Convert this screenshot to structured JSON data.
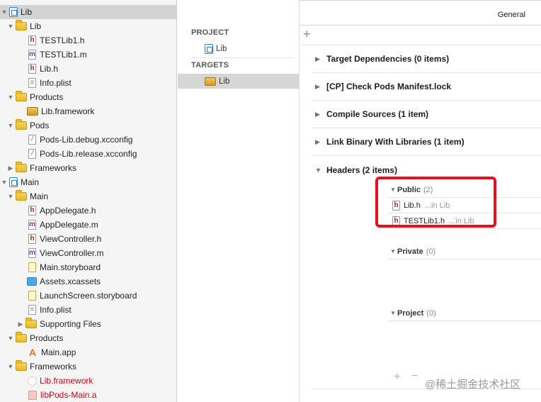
{
  "navigator": {
    "rows": [
      {
        "label": "Lib",
        "icon": "project-icon",
        "depth": 0,
        "disclosure": "expanded",
        "selected": true
      },
      {
        "label": "Lib",
        "icon": "folder-icon",
        "depth": 1,
        "disclosure": "expanded"
      },
      {
        "label": "TESTLib1.h",
        "icon": "header-file-icon",
        "depth": 2
      },
      {
        "label": "TESTLib1.m",
        "icon": "objc-file-icon",
        "depth": 2
      },
      {
        "label": "Lib.h",
        "icon": "header-file-icon",
        "depth": 2
      },
      {
        "label": "Info.plist",
        "icon": "plist-file-icon",
        "depth": 2
      },
      {
        "label": "Products",
        "icon": "folder-icon",
        "depth": 1,
        "disclosure": "expanded"
      },
      {
        "label": "Lib.framework",
        "icon": "framework-icon",
        "depth": 2
      },
      {
        "label": "Pods",
        "icon": "folder-icon",
        "depth": 1,
        "disclosure": "expanded"
      },
      {
        "label": "Pods-Lib.debug.xcconfig",
        "icon": "xcconfig-file-icon",
        "depth": 2
      },
      {
        "label": "Pods-Lib.release.xcconfig",
        "icon": "xcconfig-file-icon",
        "depth": 2
      },
      {
        "label": "Frameworks",
        "icon": "folder-icon",
        "depth": 1,
        "disclosure": "collapsed"
      },
      {
        "label": "Main",
        "icon": "project-icon",
        "depth": 0,
        "disclosure": "expanded"
      },
      {
        "label": "Main",
        "icon": "folder-icon",
        "depth": 1,
        "disclosure": "expanded"
      },
      {
        "label": "AppDelegate.h",
        "icon": "header-file-icon",
        "depth": 2
      },
      {
        "label": "AppDelegate.m",
        "icon": "objc-file-icon",
        "depth": 2
      },
      {
        "label": "ViewController.h",
        "icon": "header-file-icon",
        "depth": 2
      },
      {
        "label": "ViewController.m",
        "icon": "objc-file-icon",
        "depth": 2
      },
      {
        "label": "Main.storyboard",
        "icon": "storyboard-file-icon",
        "depth": 2
      },
      {
        "label": "Assets.xcassets",
        "icon": "assets-icon",
        "depth": 2
      },
      {
        "label": "LaunchScreen.storyboard",
        "icon": "storyboard-file-icon",
        "depth": 2
      },
      {
        "label": "Info.plist",
        "icon": "plist-file-icon",
        "depth": 2
      },
      {
        "label": "Supporting Files",
        "icon": "folder-icon",
        "depth": 2,
        "disclosure": "collapsed"
      },
      {
        "label": "Products",
        "icon": "folder-icon",
        "depth": 1,
        "disclosure": "expanded"
      },
      {
        "label": "Main.app",
        "icon": "app-icon",
        "depth": 2
      },
      {
        "label": "Frameworks",
        "icon": "folder-icon",
        "depth": 1,
        "disclosure": "expanded"
      },
      {
        "label": "Lib.framework",
        "icon": "missing-framework-icon",
        "depth": 2,
        "red": true
      },
      {
        "label": "libPods-Main.a",
        "icon": "static-lib-icon",
        "depth": 2,
        "red": true
      }
    ]
  },
  "tabs": {
    "general": "General"
  },
  "targets_panel": {
    "project_header": "PROJECT",
    "project_item": "Lib",
    "targets_header": "TARGETS",
    "target_item": "Lib"
  },
  "build_phases": {
    "add_symbol": "+",
    "phases": [
      {
        "label": "Target Dependencies (0 items)",
        "expanded": false
      },
      {
        "label": "[CP] Check Pods Manifest.lock",
        "expanded": false
      },
      {
        "label": "Compile Sources (1 item)",
        "expanded": false
      },
      {
        "label": "Link Binary With Libraries (1 item)",
        "expanded": false
      },
      {
        "label": "Headers (2 items)",
        "expanded": true
      }
    ],
    "headers": {
      "public": {
        "title": "Public",
        "count": "(2)"
      },
      "public_files": [
        {
          "name": "Lib.h",
          "location": "...in Lib"
        },
        {
          "name": "TESTLib1.h",
          "location": "...in Lib"
        }
      ],
      "private": {
        "title": "Private",
        "count": "(0)"
      },
      "project": {
        "title": "Project",
        "count": "(0)"
      }
    },
    "plus_symbol": "+",
    "minus_symbol": "−",
    "highlight_color": "#e8111b"
  },
  "watermark": "@稀土掘金技术社区",
  "colors": {
    "accent": "#1a7cff",
    "missing_file_red": "#d0021b"
  }
}
